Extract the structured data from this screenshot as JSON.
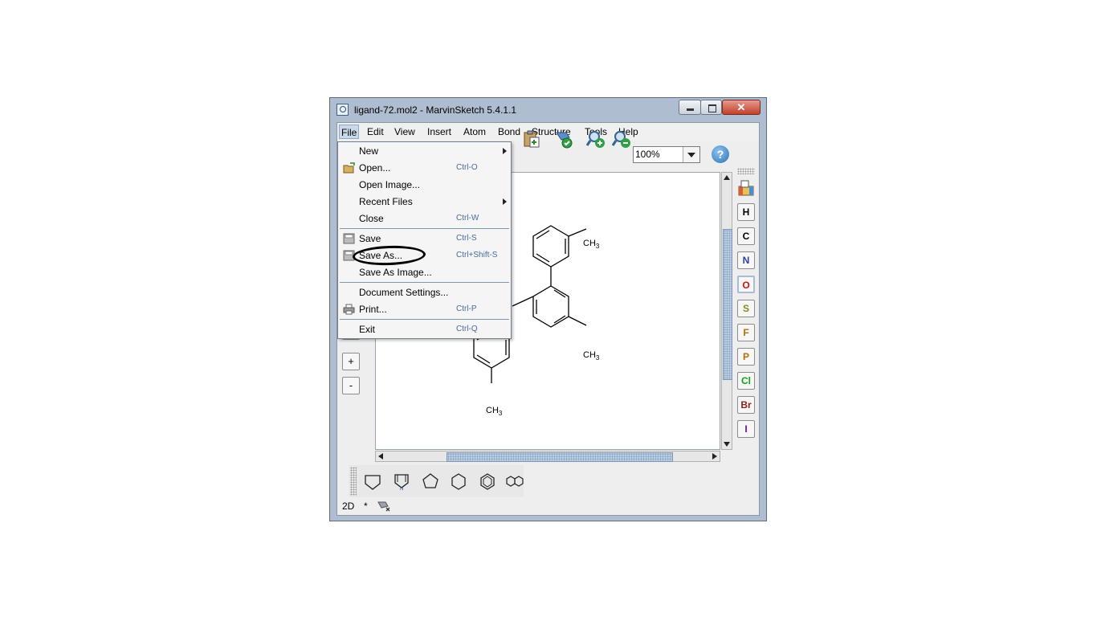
{
  "window": {
    "title": "ligand-72.mol2 - MarvinSketch 5.4.1.1",
    "close_glyph": "✕"
  },
  "menubar": {
    "items": [
      "File",
      "Edit",
      "View",
      "Insert",
      "Atom",
      "Bond",
      "Structure",
      "Tools",
      "Help"
    ],
    "active": "File"
  },
  "toolbar": {
    "zoom": "100%",
    "help": "?"
  },
  "file_menu": {
    "items": [
      {
        "label": "New",
        "shortcut": "",
        "submenu": true
      },
      {
        "label": "Open...",
        "shortcut": "Ctrl-O",
        "icon": "open-icon"
      },
      {
        "label": "Open Image...",
        "shortcut": ""
      },
      {
        "label": "Recent Files",
        "shortcut": "",
        "submenu": true
      },
      {
        "label": "Close",
        "shortcut": "Ctrl-W"
      },
      {
        "label": "Save",
        "shortcut": "Ctrl-S",
        "icon": "save-icon"
      },
      {
        "label": "Save As...",
        "shortcut": "Ctrl+Shift-S",
        "icon": "save-as-icon",
        "highlighted": true
      },
      {
        "label": "Save As Image...",
        "shortcut": ""
      },
      {
        "label": "Document Settings...",
        "shortcut": ""
      },
      {
        "label": "Print...",
        "shortcut": "Ctrl-P",
        "icon": "print-icon"
      },
      {
        "label": "Exit",
        "shortcut": "Ctrl-Q"
      }
    ]
  },
  "left_tools": [
    "+",
    "-"
  ],
  "atoms": [
    {
      "symbol": "H",
      "color": "#000000"
    },
    {
      "symbol": "C",
      "color": "#000000"
    },
    {
      "symbol": "N",
      "color": "#2b3fa8"
    },
    {
      "symbol": "O",
      "color": "#d01010"
    },
    {
      "symbol": "S",
      "color": "#8a8a20"
    },
    {
      "symbol": "F",
      "color": "#b07010"
    },
    {
      "symbol": "P",
      "color": "#b07010"
    },
    {
      "symbol": "Cl",
      "color": "#10a010"
    },
    {
      "symbol": "Br",
      "color": "#8a2020"
    },
    {
      "symbol": "I",
      "color": "#6a10a0"
    }
  ],
  "molecule": {
    "labels": [
      {
        "text": "CH",
        "sub": "3"
      },
      {
        "text": "CH",
        "sub": "3"
      },
      {
        "text": "CH",
        "sub": "3"
      }
    ]
  },
  "templates": [
    "cyclohexane-chair",
    "pyrrole-like",
    "cyclopentane",
    "cyclohexane",
    "benzene",
    "naphthalene"
  ],
  "status": {
    "mode": "2D",
    "modified": "*"
  }
}
